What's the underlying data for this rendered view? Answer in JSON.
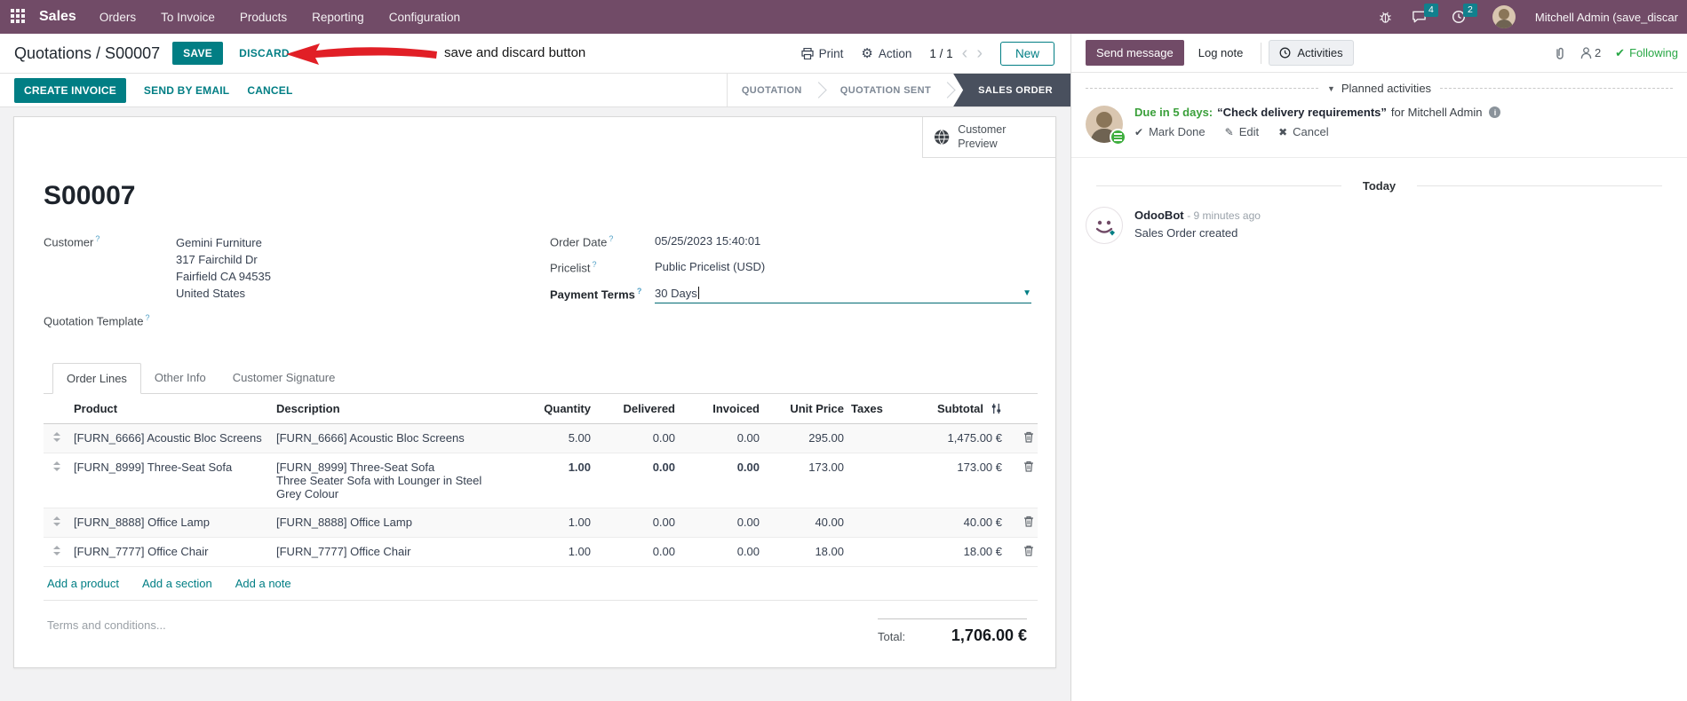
{
  "topbar": {
    "app": "Sales",
    "menus": [
      "Orders",
      "To Invoice",
      "Products",
      "Reporting",
      "Configuration"
    ],
    "badges": {
      "messages": "4",
      "activities": "2"
    },
    "user": "Mitchell Admin (save_discar"
  },
  "control": {
    "breadcrumb": "Quotations / S00007",
    "save": "SAVE",
    "discard": "DISCARD",
    "print": "Print",
    "action": "Action",
    "pager": "1 / 1",
    "new": "New"
  },
  "annotation": {
    "text": "save and discard button"
  },
  "actions": {
    "create_invoice": "CREATE INVOICE",
    "send_by_email": "SEND BY EMAIL",
    "cancel": "CANCEL"
  },
  "status": {
    "steps": [
      "QUOTATION",
      "QUOTATION SENT",
      "SALES ORDER"
    ],
    "active_step": "SALES ORDER"
  },
  "form": {
    "preview": "Customer Preview",
    "title": "S00007",
    "customer_label": "Customer",
    "customer": "Gemini Furniture",
    "address": [
      "317 Fairchild Dr",
      "Fairfield CA 94535",
      "United States"
    ],
    "quotation_template_label": "Quotation Template",
    "order_date_label": "Order Date",
    "order_date": "05/25/2023 15:40:01",
    "pricelist_label": "Pricelist",
    "pricelist": "Public Pricelist (USD)",
    "payment_terms_label": "Payment Terms",
    "payment_terms": "30 Days"
  },
  "tabs": [
    "Order Lines",
    "Other Info",
    "Customer Signature"
  ],
  "table": {
    "headers": {
      "product": "Product",
      "description": "Description",
      "quantity": "Quantity",
      "delivered": "Delivered",
      "invoiced": "Invoiced",
      "unit_price": "Unit Price",
      "taxes": "Taxes",
      "subtotal": "Subtotal"
    },
    "rows": [
      {
        "product": "[FURN_6666] Acoustic Bloc Screens",
        "desc1": "[FURN_6666] Acoustic Bloc Screens",
        "desc2": "",
        "quantity": "5.00",
        "delivered": "0.00",
        "invoiced": "0.00",
        "unit_price": "295.00",
        "taxes": "",
        "subtotal": "1,475.00 €"
      },
      {
        "product": "[FURN_8999] Three-Seat Sofa",
        "desc1": "[FURN_8999] Three-Seat Sofa",
        "desc2": "Three Seater Sofa with Lounger in Steel Grey Colour",
        "quantity": "1.00",
        "delivered": "0.00",
        "invoiced": "0.00",
        "unit_price": "173.00",
        "taxes": "",
        "subtotal": "173.00 €"
      },
      {
        "product": "[FURN_8888] Office Lamp",
        "desc1": "[FURN_8888] Office Lamp",
        "desc2": "",
        "quantity": "1.00",
        "delivered": "0.00",
        "invoiced": "0.00",
        "unit_price": "40.00",
        "taxes": "",
        "subtotal": "40.00 €"
      },
      {
        "product": "[FURN_7777] Office Chair",
        "desc1": "[FURN_7777] Office Chair",
        "desc2": "",
        "quantity": "1.00",
        "delivered": "0.00",
        "invoiced": "0.00",
        "unit_price": "18.00",
        "taxes": "",
        "subtotal": "18.00 €"
      }
    ],
    "links": [
      "Add a product",
      "Add a section",
      "Add a note"
    ],
    "terms_placeholder": "Terms and conditions...",
    "total_label": "Total:",
    "total_value": "1,706.00 €"
  },
  "chatter": {
    "send_message": "Send message",
    "log_note": "Log note",
    "activities": "Activities",
    "followers_count": "2",
    "following": "Following",
    "planned_header": "Planned activities",
    "activity": {
      "due": "Due in 5 days:",
      "title": "“Check delivery requirements”",
      "for_text": "for Mitchell Admin",
      "mark_done": "Mark Done",
      "edit": "Edit",
      "cancel": "Cancel"
    },
    "today": "Today",
    "message": {
      "author": "OdooBot",
      "time": "- 9 minutes ago",
      "body": "Sales Order created"
    }
  },
  "colors": {
    "brand": "#714B67",
    "accent": "#017E84",
    "badge": "#11808D",
    "status_active": "#49505E",
    "success": "#3BA03B",
    "following_green": "#28a745",
    "highlight_number": "#0B87A9",
    "annotation_arrow": "#E11F26"
  }
}
